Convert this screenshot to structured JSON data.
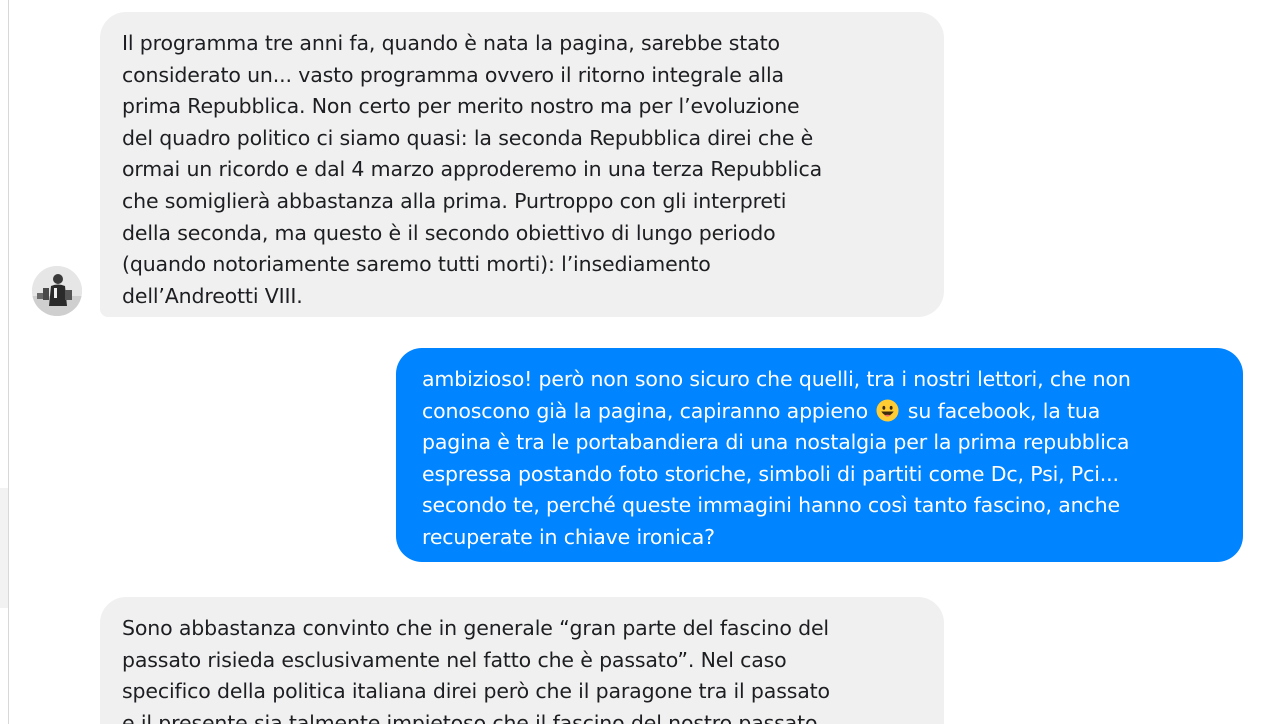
{
  "conversation": {
    "messages": [
      {
        "sender": "contact",
        "lines": [
          "Il programma tre anni fa, quando è nata la pagina, sarebbe stato",
          "considerato un... vasto programma ovvero il ritorno integrale alla",
          "prima Repubblica. Non certo per merito nostro ma per l’evoluzione",
          "del quadro politico ci siamo quasi: la seconda Repubblica direi che è",
          "ormai un ricordo e dal 4 marzo approderemo in una terza Repubblica",
          "che somiglierà abbastanza alla prima. Purtroppo con gli interpreti",
          "della seconda, ma questo è il secondo obiettivo di lungo periodo",
          "(quando notoriamente saremo tutti morti): l’insediamento",
          "dell’Andreotti VIII."
        ]
      },
      {
        "sender": "me",
        "line1": "ambizioso! però non sono sicuro che quelli, tra i nostri lettori, che non",
        "line2_before_emoji": "conoscono già la pagina, capiranno appieno",
        "emoji": "smiling-face-emoji",
        "line2_after_emoji": "su facebook, la tua",
        "lines_rest": [
          "pagina è tra le portabandiera di una nostalgia per la prima repubblica",
          "espressa postando foto storiche, simboli di partiti come Dc, Psi, Pci...",
          "secondo te, perché queste immagini hanno così tanto fascino, anche",
          "recuperate in chiave ironica?"
        ]
      },
      {
        "sender": "contact",
        "lines": [
          "Sono abbastanza convinto che in generale “gran parte del fascino del",
          "passato risieda esclusivamente nel fatto che è passato”. Nel caso",
          "specifico della politica italiana direi però che il paragone tra il passato",
          "e il presente sia talmente impietoso che il fascino del nostro passato"
        ]
      }
    ]
  },
  "colors": {
    "incoming_bubble": "#f1f0f0",
    "outgoing_bubble": "#0084ff",
    "incoming_text": "#1c1e21",
    "outgoing_text": "#ffffff",
    "emoji_face": "#ffcc33"
  }
}
